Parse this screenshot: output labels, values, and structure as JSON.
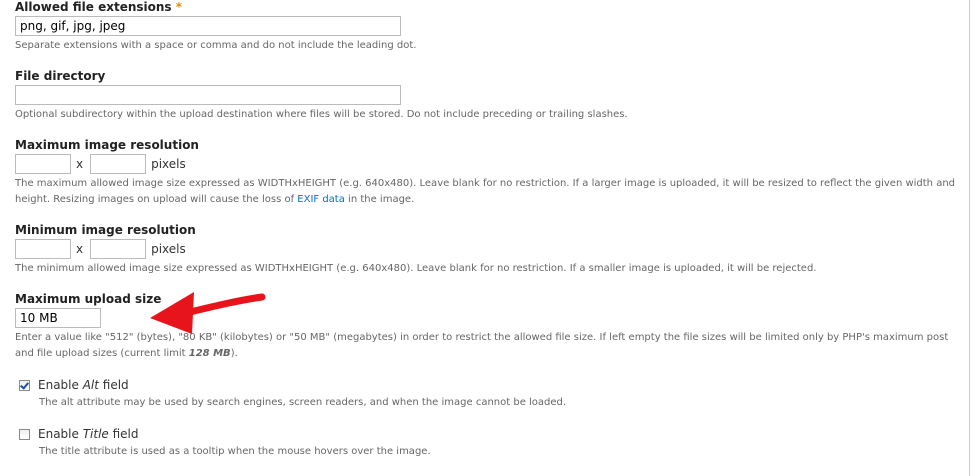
{
  "extensions": {
    "label": "Allowed file extensions",
    "required_mark": "*",
    "value": "png, gif, jpg, jpeg",
    "description": "Separate extensions with a space or comma and do not include the leading dot."
  },
  "directory": {
    "label": "File directory",
    "value": "",
    "description": "Optional subdirectory within the upload destination where files will be stored. Do not include preceding or trailing slashes."
  },
  "max_resolution": {
    "label": "Maximum image resolution",
    "width": "",
    "height": "",
    "separator": "x",
    "unit": "pixels",
    "description_before": "The maximum allowed image size expressed as WIDTHxHEIGHT (e.g. 640x480). Leave blank for no restriction. If a larger image is uploaded, it will be resized to reflect the given width and height. Resizing images on upload will cause the loss of ",
    "description_link": "EXIF data",
    "description_after": " in the image."
  },
  "min_resolution": {
    "label": "Minimum image resolution",
    "width": "",
    "height": "",
    "separator": "x",
    "unit": "pixels",
    "description": "The minimum allowed image size expressed as WIDTHxHEIGHT (e.g. 640x480). Leave blank for no restriction. If a smaller image is uploaded, it will be rejected."
  },
  "upload_size": {
    "label": "Maximum upload size",
    "value": "10 MB",
    "description_before": "Enter a value like \"512\" (bytes), \"80 KB\" (kilobytes) or \"50 MB\" (megabytes) in order to restrict the allowed file size. If left empty the file sizes will be limited only by PHP's maximum post and file upload sizes (current limit ",
    "description_limit": "128 MB",
    "description_after": ")."
  },
  "alt_field": {
    "checked": true,
    "label_before": "Enable ",
    "label_italic": "Alt",
    "label_after": " field",
    "description": "The alt attribute may be used by search engines, screen readers, and when the image cannot be loaded."
  },
  "title_field": {
    "checked": false,
    "label_before": "Enable ",
    "label_italic": "Title",
    "label_after": " field",
    "description": "The title attribute is used as a tooltip when the mouse hovers over the image."
  },
  "colors": {
    "link": "#0074bd",
    "required": "#e09010",
    "arrow": "#e8141c"
  },
  "annotation": {
    "icon": "red-arrow-icon"
  }
}
